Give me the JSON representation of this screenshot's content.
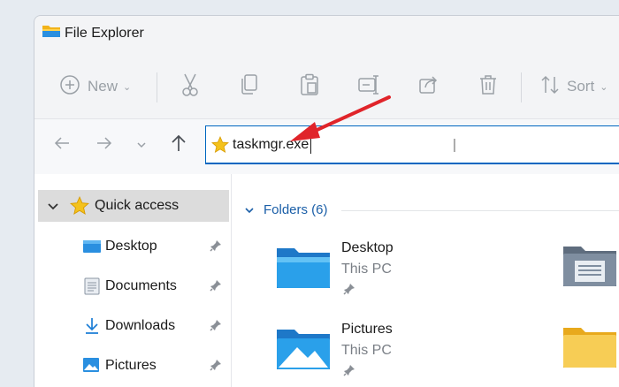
{
  "window": {
    "title": "File Explorer"
  },
  "toolbar": {
    "new_label": "New",
    "sort_label": "Sort"
  },
  "address": {
    "value": "taskmgr.exe"
  },
  "sidebar": {
    "quick_access": "Quick access",
    "items": [
      {
        "label": "Desktop"
      },
      {
        "label": "Documents"
      },
      {
        "label": "Downloads"
      },
      {
        "label": "Pictures"
      }
    ]
  },
  "main": {
    "folders_header": "Folders (6)",
    "folders": [
      {
        "name": "Desktop",
        "location": "This PC"
      },
      {
        "name": "Pictures",
        "location": "This PC"
      }
    ]
  },
  "colors": {
    "accent": "#0067c0",
    "arrow": "#e0242a",
    "folder_blue": "#2a8fe0",
    "folder_yellow": "#f5c542"
  }
}
